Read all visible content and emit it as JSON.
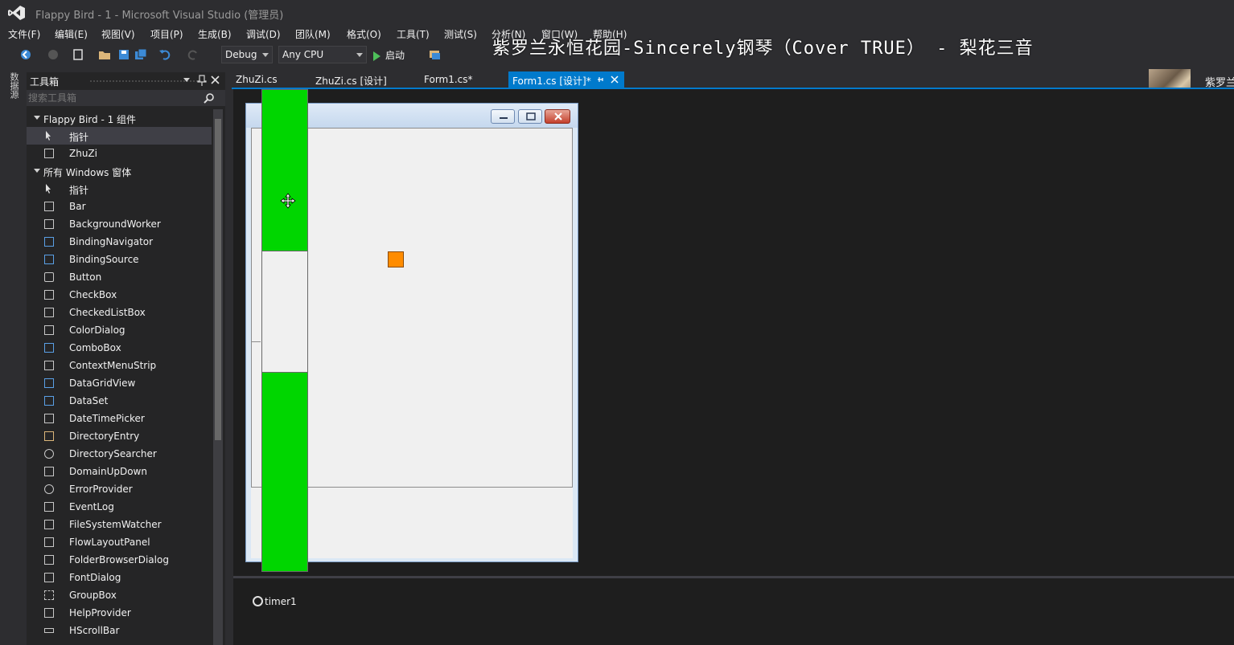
{
  "window": {
    "title": "Flappy Bird - 1 - Microsoft Visual Studio (管理员)"
  },
  "menu": {
    "items": [
      "文件(F)",
      "编辑(E)",
      "视图(V)",
      "项目(P)",
      "生成(B)",
      "调试(D)",
      "团队(M)",
      "格式(O)",
      "工具(T)",
      "测试(S)",
      "分析(N)",
      "窗口(W)",
      "帮助(H)"
    ]
  },
  "toolbar": {
    "config_value": "Debug",
    "platform_value": "Any CPU",
    "start_label": "启动"
  },
  "overlay": {
    "song_caption": "紫罗兰永恒花园-Sincerely钢琴（Cover TRUE） - 梨花三音",
    "album_text": "紫罗兰"
  },
  "left_strip": {
    "label": "数据源"
  },
  "toolbox": {
    "title": "工具箱",
    "search_placeholder": "搜索工具箱",
    "groups": [
      {
        "label": "Flappy Bird - 1 组件",
        "items": [
          "指针",
          "ZhuZi"
        ]
      },
      {
        "label": "所有 Windows 窗体",
        "items": [
          "指针",
          "Bar",
          "BackgroundWorker",
          "BindingNavigator",
          "BindingSource",
          "Button",
          "CheckBox",
          "CheckedListBox",
          "ColorDialog",
          "ComboBox",
          "ContextMenuStrip",
          "DataGridView",
          "DataSet",
          "DateTimePicker",
          "DirectoryEntry",
          "DirectorySearcher",
          "DomainUpDown",
          "ErrorProvider",
          "EventLog",
          "FileSystemWatcher",
          "FlowLayoutPanel",
          "FolderBrowserDialog",
          "FontDialog",
          "GroupBox",
          "HelpProvider",
          "HScrollBar"
        ]
      }
    ]
  },
  "doc_tabs": [
    {
      "label": "ZhuZi.cs",
      "active": false
    },
    {
      "label": "ZhuZi.cs [设计]",
      "active": false
    },
    {
      "label": "Form1.cs*",
      "active": false
    },
    {
      "label": "Form1.cs [设计]*",
      "active": true
    }
  ],
  "tray": {
    "components": [
      "timer1"
    ]
  },
  "colors": {
    "accent": "#007acc",
    "pipe": "#00d600",
    "bird": "#ff8c00",
    "ide_bg": "#2d2d30",
    "designer_bg": "#1e1e1e"
  }
}
